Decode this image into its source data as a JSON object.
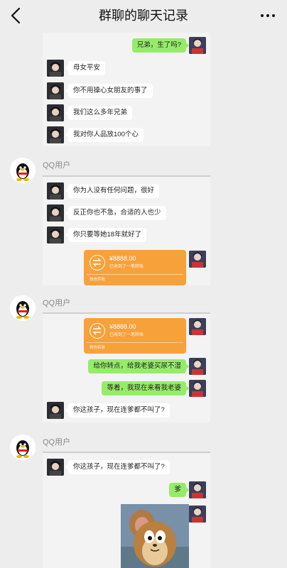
{
  "header": {
    "title": "群聊的聊天记录"
  },
  "sender_name": "QQ用户",
  "shot1": {
    "sent": "兄弟，生了吗?",
    "replies": [
      "母女平安",
      "你不用操心女朋友的事了",
      "我们这么多年兄弟",
      "我对你人品放100个心"
    ]
  },
  "shot2": {
    "replies": [
      "你为人没有任何问题，很好",
      "反正你也不急，合适的人也少",
      "你只要等她18年就好了"
    ],
    "transfer": {
      "amount": "¥8888.00",
      "sub": "已收到了一笔转账",
      "foot": "微信转账"
    }
  },
  "shot3": {
    "transfer": {
      "amount": "¥8888.00",
      "sub": "已收到了一笔转账",
      "foot": "微信转账"
    },
    "sent": [
      "给你转点，给我老婆买尿不湿",
      "等着，我现在来看我老婆"
    ],
    "reply": "你这孩子，现在连爹都不叫了?"
  },
  "shot4": {
    "reply": "你这孩子，现在连爹都不叫了?",
    "sent": "爹"
  },
  "colors": {
    "bg": "#ededed",
    "green": "#95ec69",
    "orange": "#f7a13a"
  },
  "icons": {
    "back": "chevron-left-icon",
    "more": "more-dots-icon",
    "transfer": "transfer-arrows-icon"
  }
}
